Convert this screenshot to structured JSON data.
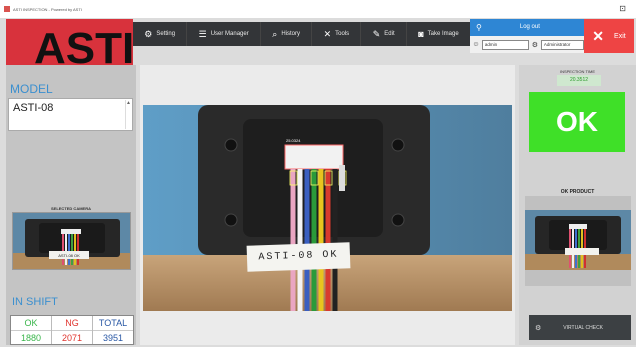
{
  "window": {
    "title": "ASTI INSPECTION - Powered by ASTI",
    "controls_label": "⊡"
  },
  "brand": {
    "logo_text": "ASTI",
    "logo_color": "#d8323c"
  },
  "toolbar": {
    "items": [
      {
        "label": "Setting",
        "icon": "gear-icon",
        "glyph": "⚙"
      },
      {
        "label": "User Manager",
        "icon": "sliders-icon",
        "glyph": "☰"
      },
      {
        "label": "History",
        "icon": "magnifier-icon",
        "glyph": "⌕"
      },
      {
        "label": "Tools",
        "icon": "tools-icon",
        "glyph": "✕"
      },
      {
        "label": "Edit",
        "icon": "pencil-icon",
        "glyph": "✎"
      },
      {
        "label": "Take Image",
        "icon": "camera-icon",
        "glyph": "◙"
      }
    ]
  },
  "account": {
    "logout_label": "Log out",
    "user_value": "admin",
    "role_value": "Administrator"
  },
  "exit": {
    "label": "Exit"
  },
  "left": {
    "model_label": "MODEL",
    "model_value": "ASTI-08",
    "selected_camera_label": "SELECTED CAMERA",
    "in_shift_label": "IN SHIFT",
    "counts": [
      {
        "header": "OK",
        "value": "1880",
        "color": "#39b54a"
      },
      {
        "header": "NG",
        "value": "2071",
        "color": "#e0332d"
      },
      {
        "header": "TOTAL",
        "value": "3951",
        "color": "#2857a4"
      }
    ]
  },
  "camera_view": {
    "label_text": "ASTI-08 OK",
    "detection_tag": "25.0324"
  },
  "right": {
    "inspection_time_label": "INSPECTION TIME",
    "inspection_time_value": "20.3512",
    "result": "OK",
    "result_color": "#3fe028",
    "ok_product_label": "OK PRODUCT",
    "virtual_check_label": "VIRTUAL CHECK"
  }
}
